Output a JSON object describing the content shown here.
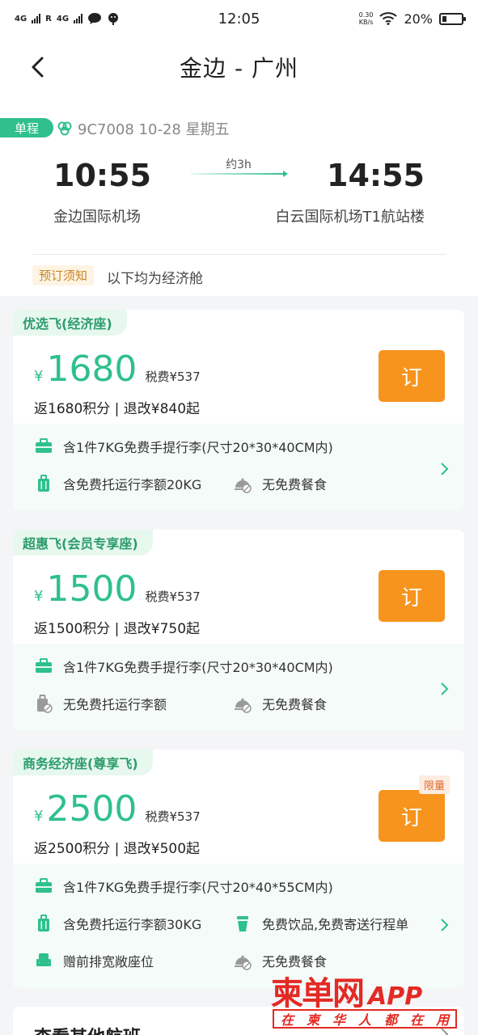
{
  "status_bar": {
    "sim1": "4G",
    "sim2": "4G",
    "roaming": "R",
    "time": "12:05",
    "net_speed_value": "0.30",
    "net_speed_unit": "KB/s",
    "battery": "20%"
  },
  "header": {
    "title": "金边 - 广州"
  },
  "flight": {
    "trip_type": "单程",
    "flight_info": "9C7008 10-28 星期五",
    "dep_time": "10:55",
    "arr_time": "14:55",
    "duration": "约3h",
    "dep_airport": "金边国际机场",
    "arr_airport": "白云国际机场T1航站楼",
    "notice_tag": "预订须知",
    "notice_text": "以下均为经济舱"
  },
  "fares": [
    {
      "tag": "优选飞(经济座)",
      "currency": "¥",
      "price": "1680",
      "tax": "税费¥537",
      "rewards": "返1680积分 | 退改¥840起",
      "book": "订",
      "perks": [
        {
          "icon": "briefcase-icon",
          "text": "含1件7KG免费手提行李(尺寸20*30*40CM内)"
        },
        {
          "icon": "luggage-icon",
          "text": "含免费托运行李额20KG"
        },
        {
          "icon": "meal-off-icon",
          "text": "无免费餐食"
        }
      ]
    },
    {
      "tag": "超惠飞(会员专享座)",
      "currency": "¥",
      "price": "1500",
      "tax": "税费¥537",
      "rewards": "返1500积分 | 退改¥750起",
      "book": "订",
      "perks": [
        {
          "icon": "briefcase-icon",
          "text": "含1件7KG免费手提行李(尺寸20*30*40CM内)"
        },
        {
          "icon": "luggage-off-icon",
          "text": "无免费托运行李额"
        },
        {
          "icon": "meal-off-icon",
          "text": "无免费餐食"
        }
      ]
    },
    {
      "tag": "商务经济座(尊享飞)",
      "currency": "¥",
      "price": "2500",
      "tax": "税费¥537",
      "rewards": "返2500积分 | 退改¥500起",
      "book": "订",
      "limited": "限量",
      "perks": [
        {
          "icon": "briefcase-icon",
          "text": "含1件7KG免费手提行李(尺寸20*40*55CM内)"
        },
        {
          "icon": "luggage-icon",
          "text": "含免费托运行李额30KG"
        },
        {
          "icon": "drink-icon",
          "text": "免费饮品,免费寄送行程单"
        },
        {
          "icon": "seat-icon",
          "text": "赠前排宽敞座位"
        },
        {
          "icon": "meal-off-icon",
          "text": "无免费餐食"
        }
      ]
    }
  ],
  "other_flights": "查看其他航班",
  "watermark": {
    "brand": "柬单网",
    "app": "APP",
    "slogan": [
      "在",
      "柬",
      "华",
      "人",
      "都",
      "在",
      "用"
    ]
  },
  "colors": {
    "accent": "#2fc08c",
    "book_button": "#f7941d",
    "watermark": "#e32a24"
  }
}
